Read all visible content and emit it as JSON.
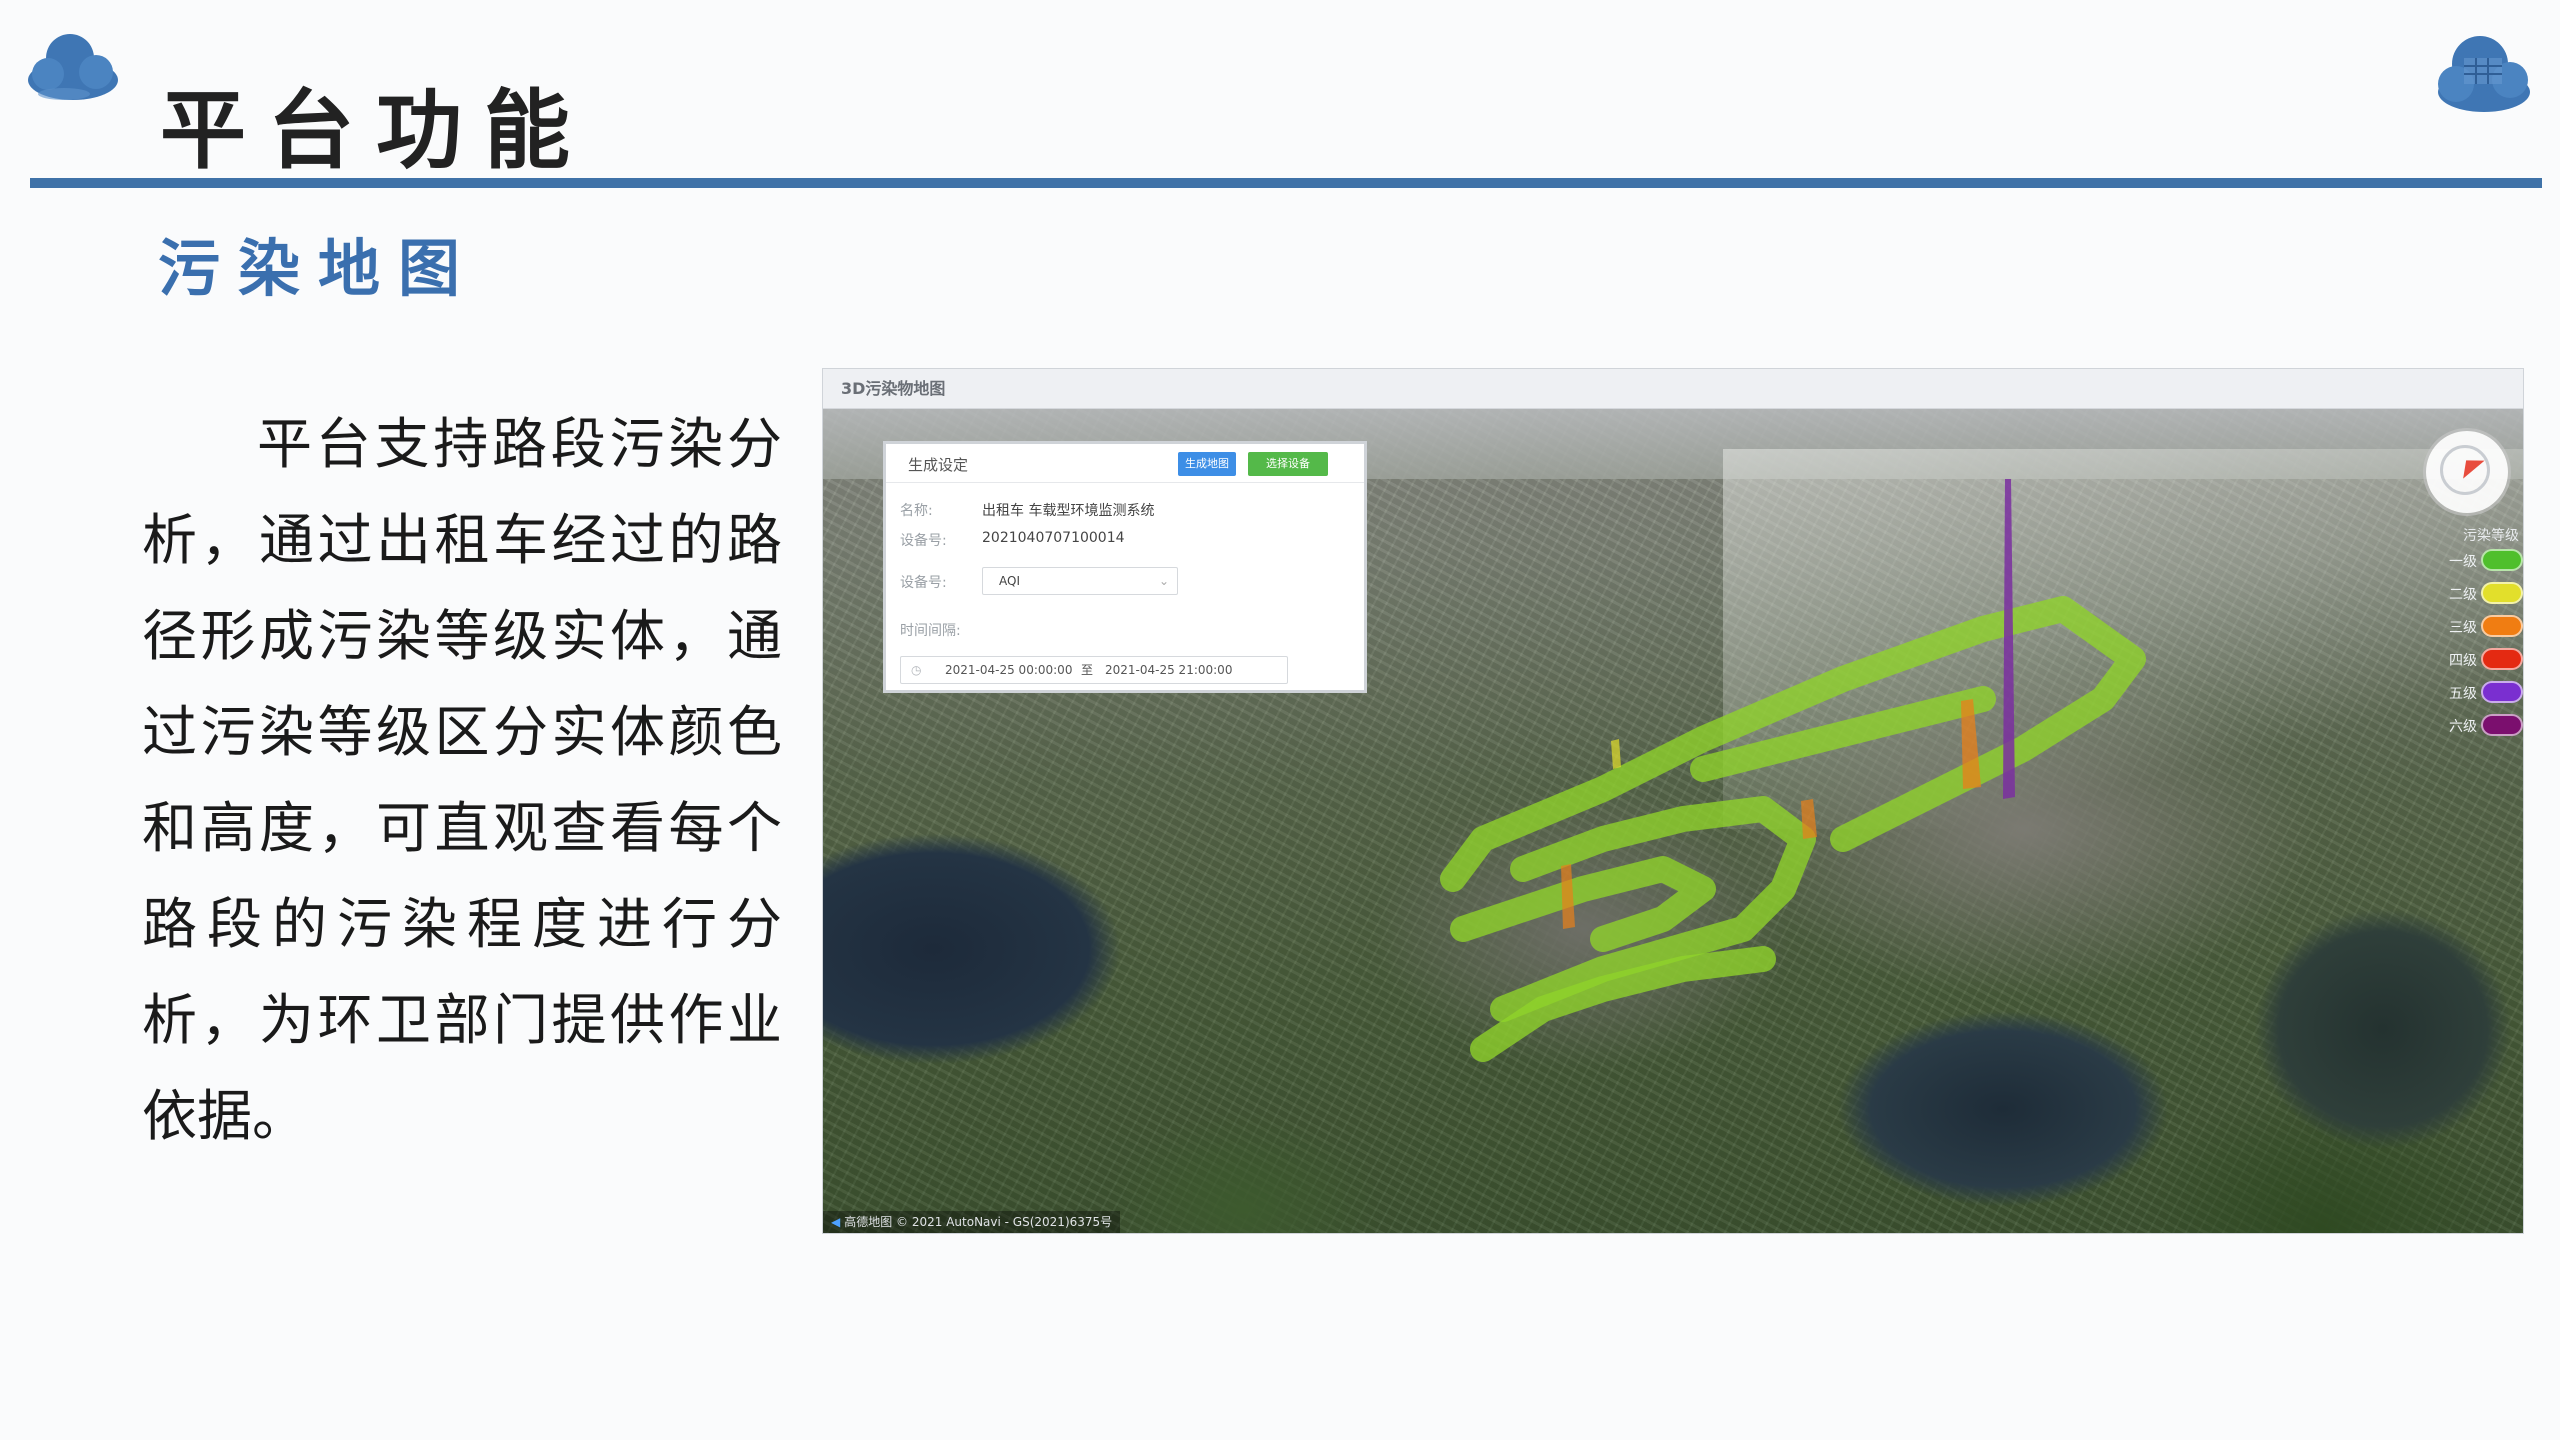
{
  "slide": {
    "title": "平台功能",
    "subtitle": "污染地图",
    "body": "平台支持路段污染分析，通过出租车经过的路径形成污染等级实体，通过污染等级区分实体颜色和高度，可直观查看每个路段的污染程度进行分析，为环卫部门提供作业依据。"
  },
  "screenshot": {
    "window_title": "3D污染物地图",
    "panel": {
      "title": "生成设定",
      "generate_button": "生成地图",
      "select_device_button": "选择设备",
      "name_label": "名称:",
      "name_value": "出租车 车载型环境监测系统",
      "device_no_label": "设备号:",
      "device_no_value": "2021040707100014",
      "device_label": "设备号:",
      "device_select_value": "AQI",
      "time_label": "时间间隔:",
      "time_start": "2021-04-25 00:00:00",
      "time_separator": "至",
      "time_end": "2021-04-25 21:00:00"
    },
    "legend": {
      "title": "污染等级",
      "items": [
        {
          "label": "一级",
          "color": "#4fbf2c"
        },
        {
          "label": "二级",
          "color": "#e2df2b"
        },
        {
          "label": "三级",
          "color": "#f07d12"
        },
        {
          "label": "四级",
          "color": "#e42a12"
        },
        {
          "label": "五级",
          "color": "#7a2fd0"
        },
        {
          "label": "六级",
          "color": "#7b0f6e"
        }
      ]
    },
    "attribution": "高德地图 © 2021 AutoNavi - GS(2021)6375号"
  },
  "colors": {
    "title_rule": "#3f72a8",
    "subtitle": "#3a6fae",
    "path_green": "#8fd32a",
    "column_purple": "#7a2fa0",
    "column_orange": "#e8801a"
  }
}
